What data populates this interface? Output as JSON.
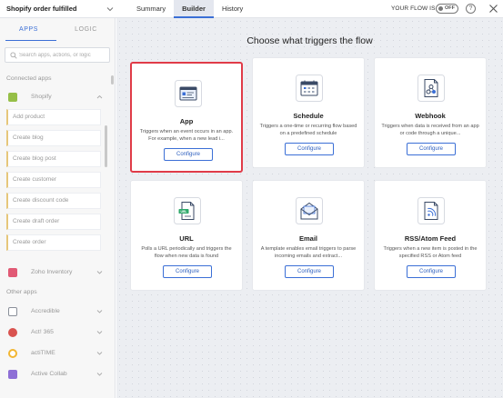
{
  "header": {
    "flow_name": "Shopify order fulfilled",
    "tabs": [
      {
        "label": "Summary"
      },
      {
        "label": "Builder"
      },
      {
        "label": "History"
      }
    ],
    "active_tab": "Builder",
    "flow_status_label": "YOUR FLOW IS",
    "flow_status_toggle": "OFF",
    "help_symbol": "?"
  },
  "sidebar": {
    "tabs": [
      {
        "label": "APPS"
      },
      {
        "label": "LOGIC"
      }
    ],
    "active_tab": "APPS",
    "search": {
      "placeholder": "Search apps, actions, or logic",
      "value": ""
    },
    "connected_label": "Connected apps",
    "connected_app": {
      "name": "Shopify",
      "logo_color": "#96bf48",
      "triggers": [
        {
          "label": "Add product"
        },
        {
          "label": "Create blog"
        },
        {
          "label": "Create blog post"
        },
        {
          "label": "Create customer"
        },
        {
          "label": "Create discount code"
        },
        {
          "label": "Create draft order"
        },
        {
          "label": "Create order"
        }
      ]
    },
    "zoho_inventory": {
      "name": "Zoho Inventory",
      "logo_color": "#e15a75"
    },
    "other_label": "Other apps",
    "other_apps": [
      {
        "name": "Accredible",
        "logo_color": "#8a8f99"
      },
      {
        "name": "Act! 365",
        "logo_color": "#d9534f"
      },
      {
        "name": "actiTIME",
        "logo_color": "#f2b632"
      },
      {
        "name": "Active Collab",
        "logo_color": "#8e6fd6"
      }
    ]
  },
  "main": {
    "heading": "Choose what triggers the flow",
    "accent_color": "#3b6fd6",
    "selected_border_color": "#e03b48",
    "triggers": [
      {
        "title": "App",
        "description": "Triggers when an event occurs in an app. For example, when a new lead i...",
        "button": "Configure",
        "icon": "app-window-icon",
        "selected": true
      },
      {
        "title": "Schedule",
        "description": "Triggers a one-time or recurring flow based on a predefined schedule",
        "button": "Configure",
        "icon": "calendar-icon",
        "selected": false
      },
      {
        "title": "Webhook",
        "description": "Triggers when data is received from an app or code through a unique...",
        "button": "Configure",
        "icon": "webhook-icon",
        "selected": false
      },
      {
        "title": "URL",
        "description": "Polls a URL periodically and triggers the flow when new data is found",
        "button": "Configure",
        "icon": "url-icon",
        "selected": false
      },
      {
        "title": "Email",
        "description": "A template enables email triggers to parse incoming emails and extract...",
        "button": "Configure",
        "icon": "email-icon",
        "selected": false
      },
      {
        "title": "RSS/Atom Feed",
        "description": "Triggers when a new item is posted in the specified RSS or Atom feed",
        "button": "Configure",
        "icon": "rss-icon",
        "selected": false
      }
    ]
  }
}
